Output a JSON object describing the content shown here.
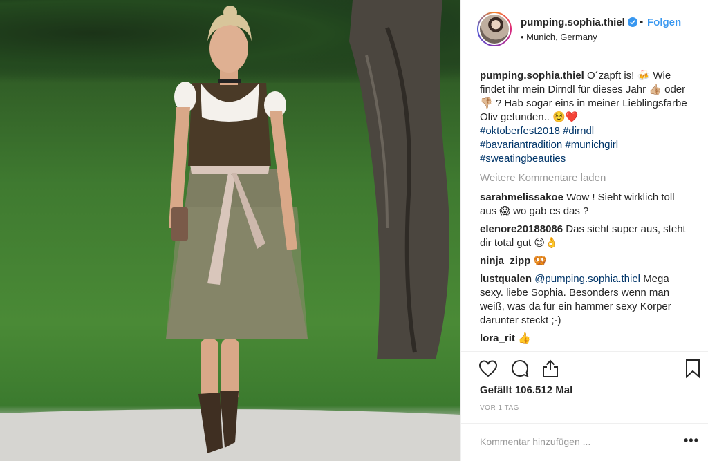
{
  "post": {
    "username": "pumping.sophia.thiel",
    "separator": "•",
    "follow_label": "Folgen",
    "location": "• Munich, Germany"
  },
  "caption": {
    "username": "pumping.sophia.thiel",
    "text_1": "O´zapft is! 🍻 Wie findet ihr mein Dirndl für dieses Jahr 👍🏼 oder 👎🏼 ? Hab sogar eins in meiner Lieblingsfarbe Oliv gefunden.. ☺️❤️",
    "hashtags": [
      "#oktoberfest2018",
      "#dirndl",
      "#bavariantradition",
      "#munichgirl",
      "#sweatingbeauties"
    ]
  },
  "more_comments_label": "Weitere Kommentare laden",
  "comments": [
    {
      "user": "sarahmelissakoe",
      "text": "Wow ! Sieht wirklich toll aus 😱 wo gab es das ?"
    },
    {
      "user": "elenore20188086",
      "text": "Das sieht super aus, steht dir total gut 😊👌"
    },
    {
      "user": "ninja_zipp",
      "text": "🥨"
    },
    {
      "user": "lustqualen",
      "mention": "@pumping.sophia.thiel",
      "text": "Mega sexy. liebe Sophia. Besonders wenn man weiß, was da für ein hammer sexy Körper darunter steckt ;-)"
    },
    {
      "user": "lora_rit",
      "text": "👍"
    }
  ],
  "likes": "Gefällt 106.512 Mal",
  "timestamp": "VOR 1 TAG",
  "add_comment_placeholder": "Kommentar hinzufügen ...",
  "more_options": "•••",
  "colors": {
    "link": "#3897f0",
    "hashtag": "#003569",
    "muted": "#999999"
  },
  "icons": [
    "verified-badge-icon",
    "heart-icon",
    "comment-icon",
    "share-icon",
    "bookmark-icon",
    "more-options-icon"
  ]
}
